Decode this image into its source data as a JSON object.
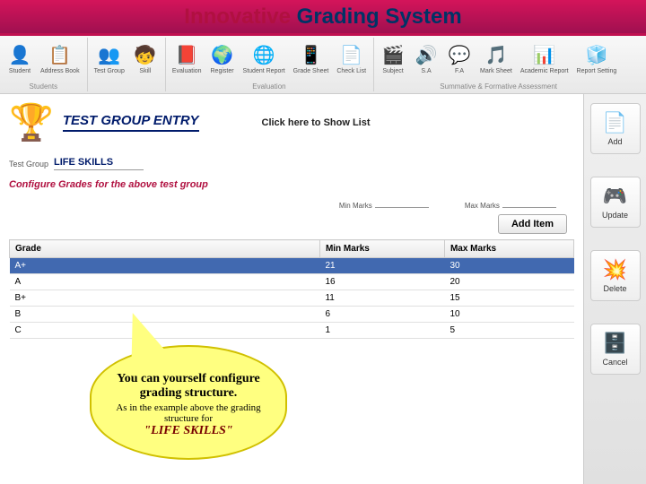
{
  "title": {
    "word1": "Innovative",
    "rest": "Grading System"
  },
  "toolbar": {
    "groups": [
      {
        "label": "Students",
        "items": [
          {
            "icon": "👤",
            "label": "Student"
          },
          {
            "icon": "📋",
            "label": "Address Book"
          }
        ]
      },
      {
        "label": "",
        "items": [
          {
            "icon": "👥",
            "label": "Test Group"
          },
          {
            "icon": "🧒",
            "label": "Skill"
          }
        ]
      },
      {
        "label": "Evaluation",
        "items": [
          {
            "icon": "📕",
            "label": "Evaluation"
          },
          {
            "icon": "🌍",
            "label": "Register"
          },
          {
            "icon": "🌐",
            "label": "Student Report"
          },
          {
            "icon": "📱",
            "label": "Grade Sheet"
          },
          {
            "icon": "📄",
            "label": "Check List"
          }
        ]
      },
      {
        "label": "Summative & Formative Assessment",
        "items": [
          {
            "icon": "🎬",
            "label": "Subject"
          },
          {
            "icon": "🔊",
            "label": "S.A"
          },
          {
            "icon": "💬",
            "label": "F.A"
          },
          {
            "icon": "🎵",
            "label": "Mark Sheet"
          },
          {
            "icon": "📊",
            "label": "Academic Report"
          },
          {
            "icon": "🧊",
            "label": "Report Setting"
          }
        ]
      }
    ]
  },
  "section": {
    "title": "TEST GROUP ENTRY",
    "show_list": "Click here to Show List",
    "test_group_label": "Test Group",
    "test_group_value": "LIFE SKILLS",
    "subheading": "Configure Grades for the above test group",
    "min_marks_label": "Min Marks",
    "max_marks_label": "Max Marks",
    "add_item": "Add Item"
  },
  "table": {
    "headers": {
      "grade": "Grade",
      "min": "Min Marks",
      "max": "Max Marks"
    },
    "rows": [
      {
        "grade": "A+",
        "min": "21",
        "max": "30",
        "selected": true
      },
      {
        "grade": "A",
        "min": "16",
        "max": "20",
        "selected": false
      },
      {
        "grade": "B+",
        "min": "11",
        "max": "15",
        "selected": false
      },
      {
        "grade": "B",
        "min": "6",
        "max": "10",
        "selected": false
      },
      {
        "grade": "C",
        "min": "1",
        "max": "5",
        "selected": false
      }
    ]
  },
  "side": {
    "add": {
      "icon": "📄",
      "label": "Add"
    },
    "update": {
      "icon": "🎮",
      "label": "Update"
    },
    "delete": {
      "icon": "💥",
      "label": "Delete"
    },
    "cancel": {
      "icon": "🗄️",
      "label": "Cancel"
    }
  },
  "callout": {
    "main": "You can yourself configure grading structure.",
    "sub": "As in the example above the grading structure for",
    "emphasis": "\"LIFE SKILLS\""
  }
}
